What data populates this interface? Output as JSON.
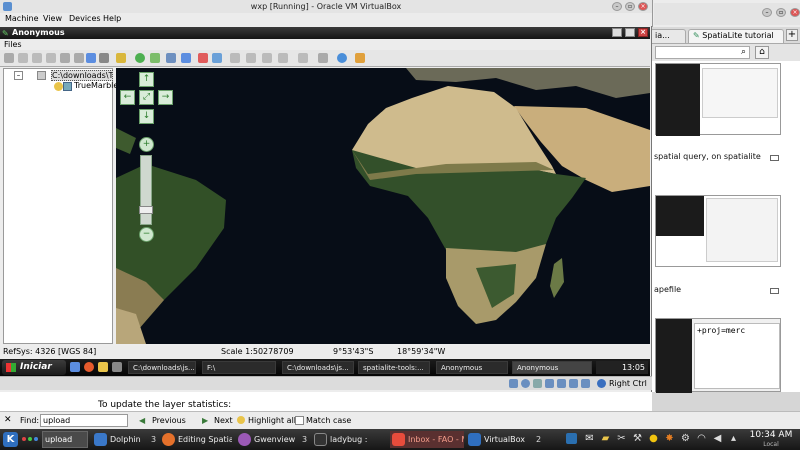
{
  "vbox": {
    "title": "wxp [Running] - Oracle VM VirtualBox",
    "menu": [
      "Machine",
      "View",
      "Devices",
      "Help"
    ]
  },
  "guest": {
    "title": "Anonymous",
    "files_menu": "Files",
    "tree": {
      "path": "C:\\downloads\\TrueM",
      "layer": "TrueMarble"
    },
    "status": {
      "refsys": "RefSys: 4326 [WGS 84]",
      "scale": "Scale 1:50278709",
      "lat": "9°53'43\"S",
      "lon": "18°59'34\"W"
    },
    "taskbar": {
      "start_label": "Iniciar",
      "items": [
        "C:\\downloads\\js...",
        "F:\\",
        "C:\\downloads\\js...",
        "spatialite-tools:...",
        "Anonymous",
        "Anonymous"
      ],
      "clock": "13:05"
    }
  },
  "vbox_status": {
    "host_key": "Right Ctrl"
  },
  "browser": {
    "tabs": [
      "ia...",
      "SpatiaLite tutorial"
    ],
    "captions": [
      "spatial query, on spatialite",
      "apefile"
    ],
    "proj_text": "+proj=merc"
  },
  "page_under": {
    "text": "To update the layer statistics:"
  },
  "findbar": {
    "label": "Find:",
    "value": "upload",
    "previous": "Previous",
    "next": "Next",
    "highlight": "Highlight all",
    "match_case": "Match case"
  },
  "kde_panel": {
    "tasks": [
      {
        "label": "Dolphin",
        "count": "3",
        "color": "#3a78c9"
      },
      {
        "label": "Editing Spatiali",
        "count": "",
        "color": "#e5712b"
      },
      {
        "label": "Gwenview",
        "count": "3",
        "color": "#9b59b6"
      },
      {
        "label": "ladybug :",
        "count": "",
        "color": "#333333"
      },
      {
        "label": "Inbox - FAO - M",
        "count": "",
        "color": "#e74c3c"
      },
      {
        "label": "VirtualBox",
        "count": "2",
        "color": "#2f6fbf"
      }
    ],
    "clock": "10:34 AM",
    "clock_sub": "Local"
  },
  "colors": {
    "africa_land": "#c8b486",
    "vegetation": "#2d4a1e",
    "ocean": "#070d17"
  }
}
